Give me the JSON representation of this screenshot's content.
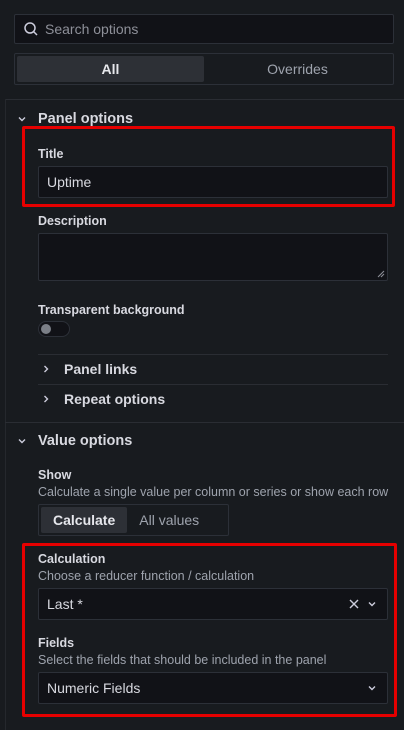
{
  "search": {
    "placeholder": "Search options"
  },
  "tabs": [
    {
      "label": "All",
      "active": true
    },
    {
      "label": "Overrides",
      "active": false
    }
  ],
  "panel_options": {
    "header": "Panel options",
    "title_label": "Title",
    "title_value": "Uptime",
    "description_label": "Description",
    "description_value": "",
    "transparent_label": "Transparent background",
    "transparent_on": false,
    "panel_links": "Panel links",
    "repeat_options": "Repeat options"
  },
  "value_options": {
    "header": "Value options",
    "show_label": "Show",
    "show_desc": "Calculate a single value per column or series or show each row",
    "show_options": [
      {
        "label": "Calculate",
        "active": true
      },
      {
        "label": "All values",
        "active": false
      }
    ],
    "calculation_label": "Calculation",
    "calculation_desc": "Choose a reducer function / calculation",
    "calculation_value": "Last *",
    "fields_label": "Fields",
    "fields_desc": "Select the fields that should be included in the panel",
    "fields_value": "Numeric Fields"
  },
  "colors": {
    "background": "#181b1f",
    "input_bg": "#111217",
    "highlight_box": "#e60000"
  }
}
